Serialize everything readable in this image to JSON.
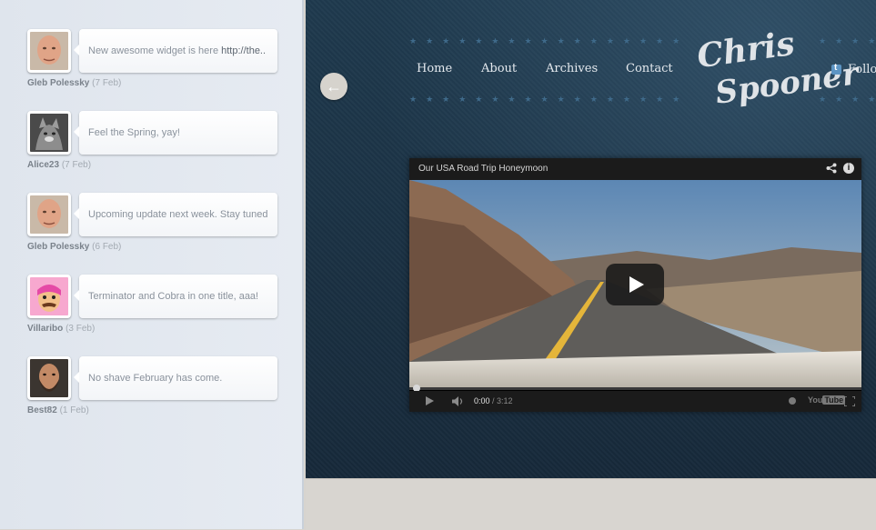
{
  "feed": {
    "items": [
      {
        "author": "Gleb Polessky",
        "date": "(7 Feb)",
        "text": "New awesome widget is here ",
        "link": "http://the..",
        "avatar_icon": "avatar-bald-man"
      },
      {
        "author": "Alice23",
        "date": "(7 Feb)",
        "text": "Feel the Spring, yay!",
        "link": "",
        "avatar_icon": "avatar-cat"
      },
      {
        "author": "Gleb Polessky",
        "date": "(6 Feb)",
        "text": "Upcoming update next week. Stay tuned!",
        "link": "",
        "avatar_icon": "avatar-bald-man"
      },
      {
        "author": "Villaribo",
        "date": "(3 Feb)",
        "text": "Terminator and Cobra in one title, aaa!",
        "link": "",
        "avatar_icon": "avatar-pink-cartoon"
      },
      {
        "author": "Best82",
        "date": "(1 Feb)",
        "text": "No shave February has come.",
        "link": "",
        "avatar_icon": "avatar-bearded-man"
      }
    ]
  },
  "site": {
    "back_symbol": "←",
    "nav": [
      {
        "label": "Home"
      },
      {
        "label": "About"
      },
      {
        "label": "Archives"
      },
      {
        "label": "Contact"
      }
    ],
    "logo_line1": "Chris",
    "logo_line2": "Spooner",
    "twitter_label": "Follo",
    "stars": "★★★★★★★★★★★★★★★★★★★★★★★★★★★★★★★★★★★★"
  },
  "video": {
    "title": "Our USA Road Trip Honeymoon",
    "current_time": "0:00",
    "duration": " / 3:12",
    "progress": 0,
    "yt_you": "You",
    "yt_tube": "Tube"
  },
  "colors": {
    "site_bg": "#1c3344",
    "feed_bg": "#e3e8ef",
    "footer_bg": "#d8d5d0"
  }
}
